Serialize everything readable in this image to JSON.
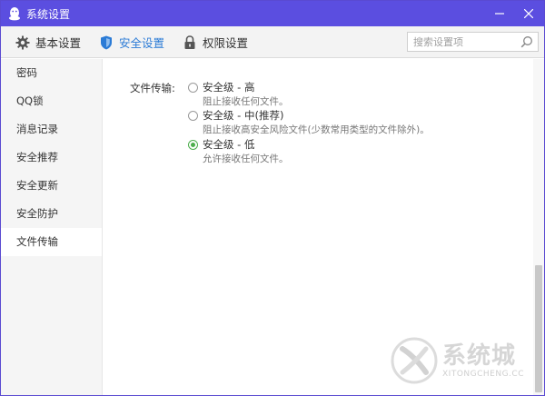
{
  "window": {
    "title": "系统设置",
    "min_label": "—",
    "close_label": "✕"
  },
  "tabs": [
    {
      "label": "基本设置",
      "icon": "gear-icon"
    },
    {
      "label": "安全设置",
      "icon": "shield-icon",
      "active": true
    },
    {
      "label": "权限设置",
      "icon": "lock-icon"
    }
  ],
  "search": {
    "placeholder": "搜索设置项",
    "value": ""
  },
  "sidebar": {
    "items": [
      {
        "label": "密码"
      },
      {
        "label": "QQ锁"
      },
      {
        "label": "消息记录"
      },
      {
        "label": "安全推荐"
      },
      {
        "label": "安全更新"
      },
      {
        "label": "安全防护"
      },
      {
        "label": "文件传输",
        "active": true
      }
    ]
  },
  "content": {
    "field_label": "文件传输:",
    "options": [
      {
        "name": "安全级 - 高",
        "desc": "阻止接收任何文件。",
        "checked": false
      },
      {
        "name": "安全级 - 中(推荐)",
        "desc": "阻止接收高安全风险文件(少数常用类型的文件除外)。",
        "checked": false
      },
      {
        "name": "安全级 - 低",
        "desc": "允许接收任何文件。",
        "checked": true
      }
    ]
  },
  "watermark": {
    "cn": "系统城",
    "en": "XITONGCHENG.CC"
  },
  "colors": {
    "titlebar": "#5b4ee0",
    "active_tab": "#2b7bd6",
    "radio_checked": "#4cae4c"
  }
}
